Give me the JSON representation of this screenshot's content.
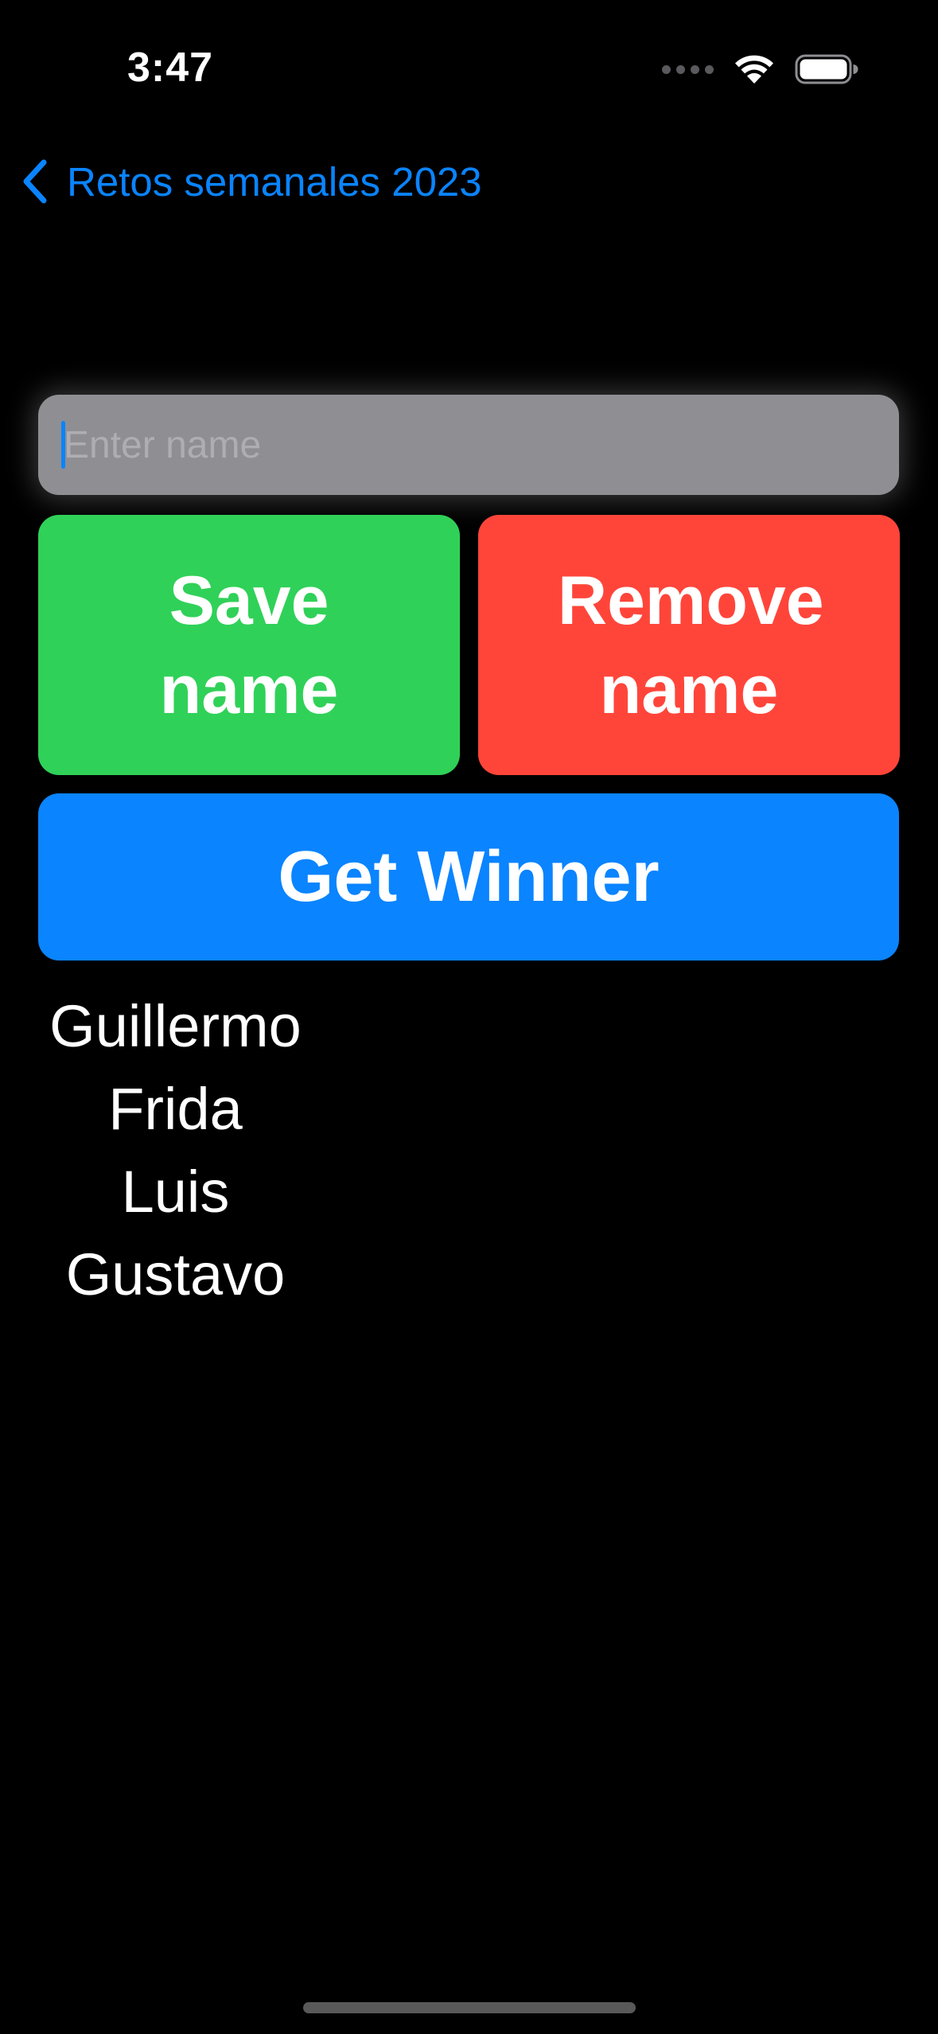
{
  "status_bar": {
    "time": "3:47",
    "icons": [
      "cellular-signal-icon",
      "wifi-icon",
      "battery-icon"
    ]
  },
  "nav": {
    "back_label": "Retos semanales 2023",
    "back_icon": "chevron-left-icon"
  },
  "form": {
    "name_input": {
      "value": "",
      "placeholder": "Enter name"
    },
    "save_button_label": "Save name",
    "remove_button_label": "Remove name",
    "get_winner_button_label": "Get Winner"
  },
  "names": [
    "Guillermo",
    "Frida",
    "Luis",
    "Gustavo"
  ],
  "colors": {
    "background": "#000000",
    "accent_blue": "#0a84ff",
    "save_green": "#30d158",
    "remove_red": "#ff453a",
    "input_gray": "#8e8e93"
  }
}
